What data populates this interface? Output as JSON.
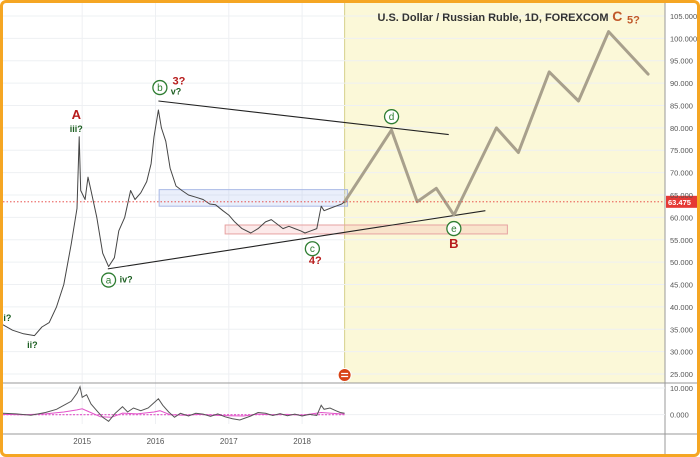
{
  "chart_data": {
    "type": "line",
    "title": "U.S. Dollar / Russian Ruble, 1D, FOREXCOM",
    "ylim": [
      23,
      107
    ],
    "y_ticks": [
      "25.000",
      "30.000",
      "35.000",
      "40.000",
      "45.000",
      "50.000",
      "55.000",
      "60.000",
      "65.000",
      "70.000",
      "75.000",
      "80.000",
      "85.000",
      "90.000",
      "95.000",
      "100.000",
      "105.000"
    ],
    "x_ticks": [
      {
        "label": "2015",
        "x": 2015.0
      },
      {
        "label": "2016",
        "x": 2016.0
      },
      {
        "label": "2017",
        "x": 2017.0
      },
      {
        "label": "2018",
        "x": 2018.0
      }
    ],
    "last_price": {
      "label": "63.475",
      "value": 63.475,
      "color": "#e53935"
    },
    "price_series": [
      [
        2013.92,
        36.0
      ],
      [
        2014.05,
        34.8
      ],
      [
        2014.2,
        34.0
      ],
      [
        2014.35,
        33.6
      ],
      [
        2014.45,
        35.5
      ],
      [
        2014.55,
        36.5
      ],
      [
        2014.65,
        40.0
      ],
      [
        2014.75,
        45.0
      ],
      [
        2014.85,
        54.0
      ],
      [
        2014.93,
        62.0
      ],
      [
        2014.96,
        78.0
      ],
      [
        2014.98,
        66.0
      ],
      [
        2015.04,
        64.0
      ],
      [
        2015.08,
        69.0
      ],
      [
        2015.12,
        66.0
      ],
      [
        2015.2,
        60.0
      ],
      [
        2015.28,
        52.0
      ],
      [
        2015.36,
        49.0
      ],
      [
        2015.44,
        51.0
      ],
      [
        2015.5,
        57.0
      ],
      [
        2015.58,
        60.0
      ],
      [
        2015.66,
        66.0
      ],
      [
        2015.72,
        64.0
      ],
      [
        2015.8,
        65.5
      ],
      [
        2015.88,
        68.0
      ],
      [
        2015.94,
        72.0
      ],
      [
        2015.98,
        78.0
      ],
      [
        2016.04,
        84.0
      ],
      [
        2016.08,
        80.0
      ],
      [
        2016.14,
        77.0
      ],
      [
        2016.2,
        71.0
      ],
      [
        2016.28,
        67.0
      ],
      [
        2016.36,
        66.0
      ],
      [
        2016.45,
        65.0
      ],
      [
        2016.55,
        64.5
      ],
      [
        2016.65,
        64.0
      ],
      [
        2016.74,
        63.0
      ],
      [
        2016.82,
        62.8
      ],
      [
        2016.92,
        61.5
      ],
      [
        2017.0,
        60.5
      ],
      [
        2017.08,
        59.0
      ],
      [
        2017.18,
        57.5
      ],
      [
        2017.3,
        56.5
      ],
      [
        2017.4,
        57.5
      ],
      [
        2017.5,
        59.0
      ],
      [
        2017.58,
        59.5
      ],
      [
        2017.66,
        58.5
      ],
      [
        2017.74,
        57.5
      ],
      [
        2017.82,
        58.0
      ],
      [
        2017.9,
        57.5
      ],
      [
        2017.98,
        57.0
      ],
      [
        2018.04,
        56.5
      ],
      [
        2018.12,
        57.0
      ],
      [
        2018.2,
        57.5
      ],
      [
        2018.26,
        62.5
      ],
      [
        2018.3,
        61.5
      ],
      [
        2018.38,
        62.0
      ],
      [
        2018.46,
        62.5
      ],
      [
        2018.54,
        63.0
      ],
      [
        2018.58,
        63.475
      ]
    ],
    "projection": [
      [
        2018.58,
        63.475
      ],
      [
        2019.22,
        79.5
      ],
      [
        2019.57,
        63.5
      ],
      [
        2019.83,
        66.5
      ],
      [
        2020.07,
        60.5
      ],
      [
        2020.65,
        80.0
      ],
      [
        2020.95,
        74.5
      ],
      [
        2021.37,
        92.5
      ],
      [
        2021.77,
        86.0
      ],
      [
        2022.18,
        101.5
      ],
      [
        2022.72,
        92.0
      ]
    ],
    "trendlines": [
      {
        "name": "upper",
        "points": [
          [
            2016.04,
            86.0
          ],
          [
            2020.0,
            78.5
          ]
        ]
      },
      {
        "name": "lower",
        "points": [
          [
            2015.35,
            48.5
          ],
          [
            2020.5,
            61.5
          ]
        ]
      }
    ],
    "highlight_zone": {
      "x_start": 2018.58,
      "color": "#fbf8d8"
    },
    "boxes": [
      {
        "x": [
          2016.05,
          2018.62
        ],
        "y": [
          62.5,
          66.2
        ],
        "color": "blue"
      },
      {
        "x": [
          2016.95,
          2020.8
        ],
        "y": [
          56.3,
          58.3
        ],
        "color": "red"
      }
    ],
    "annotations": [
      {
        "text": "i?",
        "x": 2013.98,
        "y": 37.5,
        "color": "#1b5e20",
        "circled": false,
        "size": 9
      },
      {
        "text": "ii?",
        "x": 2014.32,
        "y": 31.5,
        "color": "#1b5e20",
        "circled": false,
        "size": 9
      },
      {
        "text": "A",
        "x": 2014.92,
        "y": 83.0,
        "color": "#b71c1c",
        "circled": false,
        "size": 13
      },
      {
        "text": "iii?",
        "x": 2014.92,
        "y": 79.8,
        "color": "#1b5e20",
        "circled": false,
        "size": 9
      },
      {
        "text": "a",
        "x": 2015.36,
        "y": 46.0,
        "color": "#2e7d32",
        "circled": true,
        "size": 10
      },
      {
        "text": "iv?",
        "x": 2015.6,
        "y": 46.2,
        "color": "#1b5e20",
        "circled": false,
        "size": 9
      },
      {
        "text": "b",
        "x": 2016.06,
        "y": 89.0,
        "color": "#2e7d32",
        "circled": true,
        "size": 10
      },
      {
        "text": "3?",
        "x": 2016.32,
        "y": 90.5,
        "color": "#b71c1c",
        "circled": false,
        "size": 11
      },
      {
        "text": "v?",
        "x": 2016.28,
        "y": 88.2,
        "color": "#1b5e20",
        "circled": false,
        "size": 9
      },
      {
        "text": "c",
        "x": 2018.14,
        "y": 53.0,
        "color": "#2e7d32",
        "circled": true,
        "size": 10
      },
      {
        "text": "4?",
        "x": 2018.18,
        "y": 50.5,
        "color": "#b71c1c",
        "circled": false,
        "size": 11
      },
      {
        "text": "d",
        "x": 2019.22,
        "y": 82.5,
        "color": "#2e7d32",
        "circled": true,
        "size": 10
      },
      {
        "text": "e",
        "x": 2020.07,
        "y": 57.5,
        "color": "#2e7d32",
        "circled": true,
        "size": 10
      },
      {
        "text": "B",
        "x": 2020.07,
        "y": 54.2,
        "color": "#b71c1c",
        "circled": false,
        "size": 13
      },
      {
        "text": "C",
        "x": 2022.3,
        "y": 105.0,
        "color": "#c0582a",
        "circled": false,
        "size": 14
      },
      {
        "text": "5?",
        "x": 2022.52,
        "y": 104.2,
        "color": "#c0582a",
        "circled": false,
        "size": 11
      }
    ],
    "oscillator": {
      "ylim": [
        -3.5,
        11.5
      ],
      "ticks": [
        "10.000",
        "0.000"
      ],
      "series_dark": [
        [
          2013.92,
          0.5
        ],
        [
          2014.1,
          0.3
        ],
        [
          2014.3,
          -0.2
        ],
        [
          2014.5,
          0.8
        ],
        [
          2014.65,
          2.0
        ],
        [
          2014.75,
          3.5
        ],
        [
          2014.85,
          5.0
        ],
        [
          2014.93,
          8.0
        ],
        [
          2014.97,
          10.5
        ],
        [
          2015.0,
          6.5
        ],
        [
          2015.06,
          7.5
        ],
        [
          2015.12,
          4.0
        ],
        [
          2015.2,
          1.5
        ],
        [
          2015.28,
          -1.0
        ],
        [
          2015.36,
          -2.5
        ],
        [
          2015.45,
          0.5
        ],
        [
          2015.55,
          3.0
        ],
        [
          2015.62,
          1.0
        ],
        [
          2015.7,
          2.5
        ],
        [
          2015.8,
          1.5
        ],
        [
          2015.9,
          2.5
        ],
        [
          2015.98,
          4.5
        ],
        [
          2016.04,
          6.0
        ],
        [
          2016.1,
          3.5
        ],
        [
          2016.18,
          1.0
        ],
        [
          2016.26,
          -1.0
        ],
        [
          2016.34,
          0.5
        ],
        [
          2016.45,
          -0.5
        ],
        [
          2016.55,
          0.5
        ],
        [
          2016.65,
          0.2
        ],
        [
          2016.75,
          -0.6
        ],
        [
          2016.85,
          0.3
        ],
        [
          2016.95,
          -0.8
        ],
        [
          2017.05,
          -1.5
        ],
        [
          2017.15,
          -2.0
        ],
        [
          2017.3,
          -0.5
        ],
        [
          2017.4,
          0.8
        ],
        [
          2017.5,
          0.5
        ],
        [
          2017.6,
          -0.3
        ],
        [
          2017.7,
          0.4
        ],
        [
          2017.8,
          -0.4
        ],
        [
          2017.9,
          0.2
        ],
        [
          2018.0,
          -0.5
        ],
        [
          2018.1,
          0.1
        ],
        [
          2018.2,
          -0.3
        ],
        [
          2018.26,
          3.5
        ],
        [
          2018.3,
          2.0
        ],
        [
          2018.38,
          2.5
        ],
        [
          2018.46,
          1.5
        ],
        [
          2018.52,
          0.8
        ],
        [
          2018.58,
          0.5
        ]
      ],
      "series_pink": [
        [
          2013.92,
          0.1
        ],
        [
          2014.2,
          0.0
        ],
        [
          2014.5,
          0.3
        ],
        [
          2014.75,
          1.0
        ],
        [
          2014.93,
          1.8
        ],
        [
          2015.0,
          2.2
        ],
        [
          2015.1,
          1.0
        ],
        [
          2015.25,
          -0.8
        ],
        [
          2015.4,
          -1.0
        ],
        [
          2015.55,
          0.6
        ],
        [
          2015.75,
          0.3
        ],
        [
          2015.98,
          1.0
        ],
        [
          2016.06,
          1.5
        ],
        [
          2016.2,
          0.0
        ],
        [
          2016.4,
          -0.2
        ],
        [
          2016.6,
          0.1
        ],
        [
          2016.8,
          -0.2
        ],
        [
          2017.0,
          -0.4
        ],
        [
          2017.2,
          -0.5
        ],
        [
          2017.4,
          0.2
        ],
        [
          2017.6,
          0.0
        ],
        [
          2017.8,
          0.1
        ],
        [
          2018.0,
          -0.2
        ],
        [
          2018.26,
          0.8
        ],
        [
          2018.4,
          0.5
        ],
        [
          2018.58,
          0.2
        ]
      ]
    }
  }
}
